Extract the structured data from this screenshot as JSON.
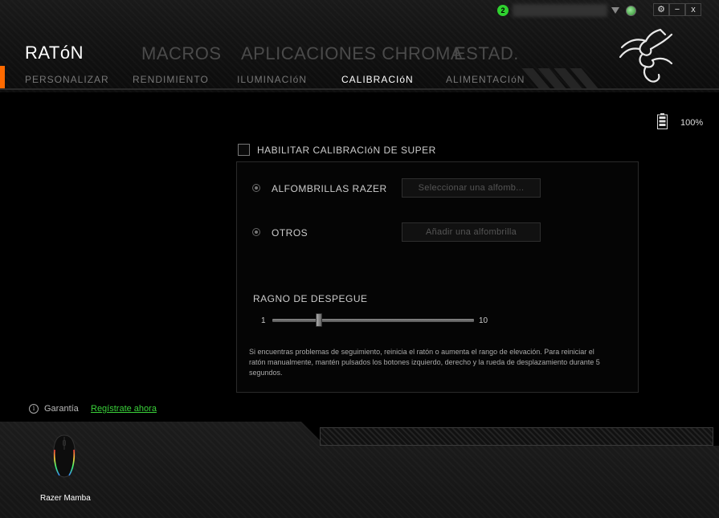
{
  "header": {
    "title": "RATóN",
    "main_tabs": [
      "MACROS",
      "APLICACIONES CHROMA",
      "ESTAD."
    ],
    "sub_tabs": [
      "PERSONALIZAR",
      "RENDIMIENTO",
      "ILUMINACIóN",
      "CALIBRACIóN",
      "ALIMENTACIóN"
    ],
    "active_sub_tab": "CALIBRACIóN"
  },
  "window": {
    "notification_count": "2",
    "settings_label": "⚙",
    "minimize_label": "−",
    "close_label": "x"
  },
  "battery": {
    "percent": "100%"
  },
  "calibration": {
    "enable_label": "HABILITAR CALIBRACIóN DE SUPER",
    "razer_pads_label": "ALFOMBRILLAS RAZER",
    "razer_pads_button": "Seleccionar una alfomb...",
    "others_label": "OTROS",
    "others_button": "Añadir una alfombrilla",
    "liftoff_label": "RAGNO DE DESPEGUE",
    "liftoff_min": "1",
    "liftoff_max": "10",
    "liftoff_value": 3,
    "help_text": "Si encuentras problemas de seguimiento, reinicia el ratón o aumenta el rango de elevación. Para reiniciar el ratón manualmente, mantén pulsados los botones izquierdo, derecho y la rueda de desplazamiento durante 5 segundos."
  },
  "footer": {
    "warranty_label": "Garantía",
    "register_link": "Regístrate ahora",
    "device_name": "Razer Mamba"
  },
  "colors": {
    "accent_orange": "#ff6a00",
    "razer_green": "#3ad23a",
    "background": "#000000"
  }
}
